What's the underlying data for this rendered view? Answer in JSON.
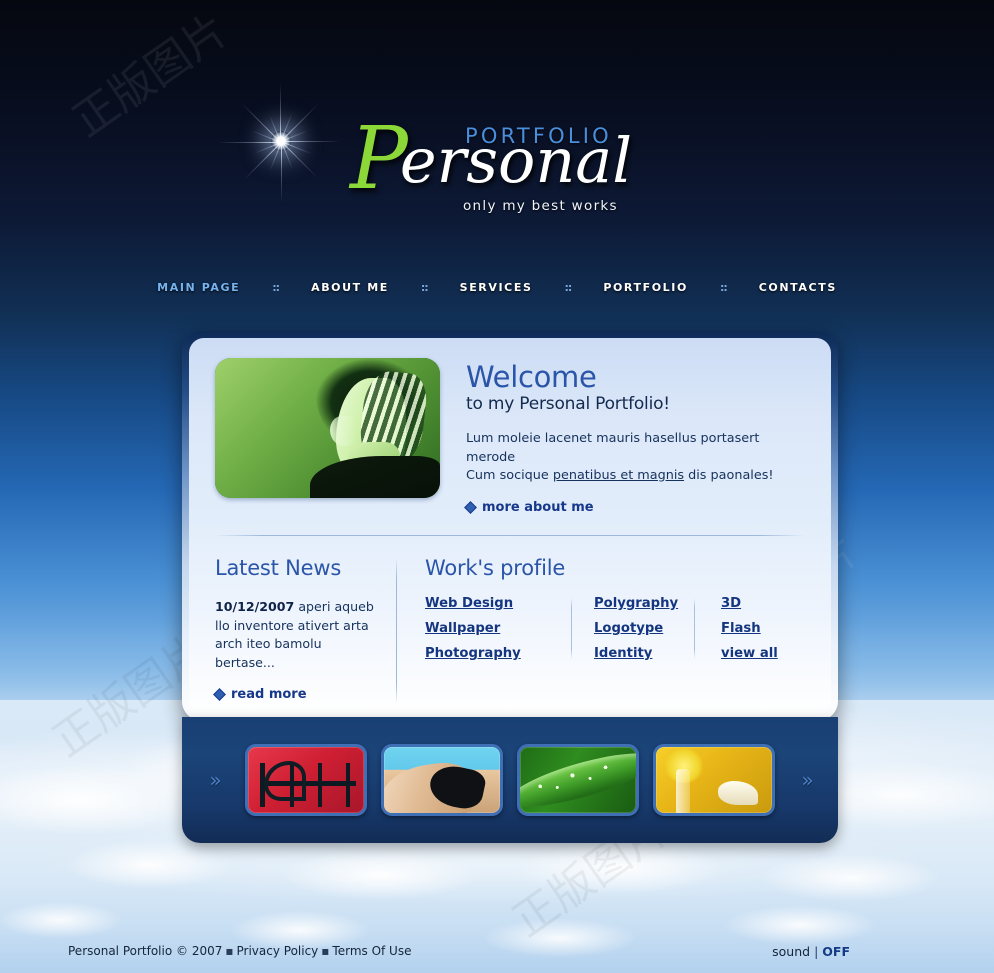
{
  "site": {
    "logo": {
      "portfolio_text": "PORTFOLIO",
      "script_cap": "P",
      "script_rest": "ersonal",
      "tagline": "only my best works"
    }
  },
  "nav": {
    "separator": "::",
    "items": [
      {
        "label": "MAIN PAGE",
        "active": true
      },
      {
        "label": "ABOUT ME",
        "active": false
      },
      {
        "label": "SERVICES",
        "active": false
      },
      {
        "label": "PORTFOLIO",
        "active": false
      },
      {
        "label": "CONTACTS",
        "active": false
      }
    ]
  },
  "hero": {
    "heading": "Welcome",
    "subheading": "to my Personal Portfolio!",
    "body_line1": "Lum moleie lacenet mauris hasellus portasert merode",
    "body_line2_pre": "Cum socique ",
    "body_line2_link": "penatibus et magnis",
    "body_line2_post": " dis paonales!",
    "cta": "more about me",
    "image_alt": "green-tinted portrait of woman in profile"
  },
  "news": {
    "title": "Latest News",
    "date": "10/12/2007",
    "text": " aperi aqueb llo inventore ativert arta arch iteo bamolu bertase...",
    "cta": "read more"
  },
  "works": {
    "title": "Work's profile",
    "columns": [
      {
        "links": [
          "Web Design",
          "Wallpaper",
          "Photography"
        ]
      },
      {
        "links": [
          "Polygraphy",
          "Logotype",
          "Identity"
        ]
      },
      {
        "links": [
          "3D",
          "Flash",
          "view all"
        ]
      }
    ]
  },
  "gallery": {
    "prev_arrow": "»",
    "next_arrow": "»",
    "thumbs": [
      {
        "name": "red-bedframe-thumb"
      },
      {
        "name": "swimsuit-thumb"
      },
      {
        "name": "dew-leaf-thumb"
      },
      {
        "name": "yellow-interior-thumb"
      }
    ]
  },
  "footer": {
    "copyright": "Personal Portfolio © 2007",
    "bullet": "▪",
    "privacy": "Privacy Policy",
    "terms": "Terms Of Use",
    "sound_label": "sound",
    "sound_divider": "|",
    "sound_state": "OFF"
  },
  "watermark": {
    "text": "正版图片"
  },
  "colors": {
    "bg_top": "#05080f",
    "sky_mid": "#2568b5",
    "accent_blue": "#2a55a8",
    "link_blue": "#14357f",
    "logo_green": "#8cd838",
    "logo_blue": "#4a8fdc",
    "panel_border": "#0d2a55",
    "gallery_bar": "#1b4478",
    "thumb_border": "#3f6fb4"
  }
}
